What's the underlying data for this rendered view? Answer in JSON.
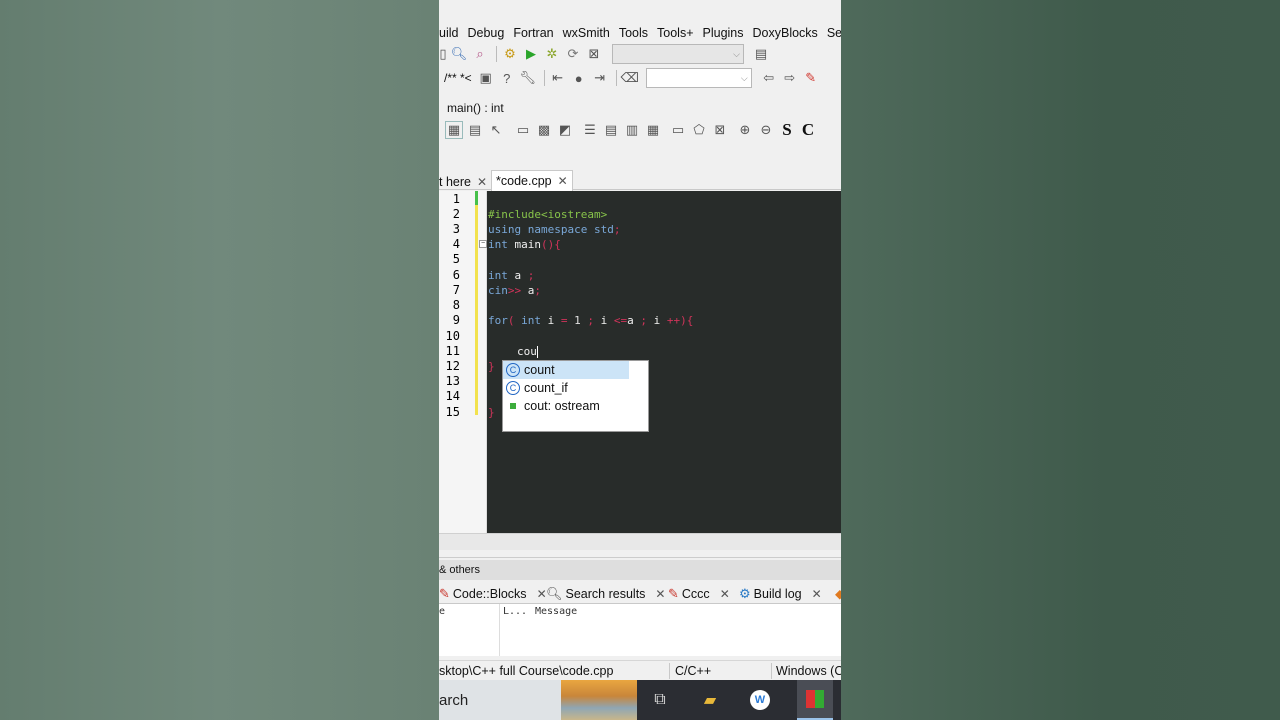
{
  "menu": [
    "uild",
    "Debug",
    "Fortran",
    "wxSmith",
    "Tools",
    "Tools+",
    "Plugins",
    "DoxyBlocks",
    "Settin"
  ],
  "toolbar2": {
    "comment_text": "/** *<"
  },
  "scope": {
    "label": "main() : int"
  },
  "wx_toolbar": {
    "s_label": "S",
    "c_label": "C"
  },
  "editor_tabs": [
    {
      "label": "t here"
    },
    {
      "label": "*code.cpp"
    }
  ],
  "line_numbers": [
    "1",
    "2",
    "3",
    "4",
    "5",
    "6",
    "7",
    "8",
    "9",
    "10",
    "11",
    "12",
    "13",
    "14",
    "15"
  ],
  "code": {
    "l2": "#include<iostream>",
    "l3_kw": "using",
    "l3_ns": " namespace std",
    "l3_end": ";",
    "l4_kw": "int",
    "l4_fn": " main",
    "l4_paren": "(){",
    "l6_kw": "int",
    "l6_var": " a ",
    "l6_end": ";",
    "l7_kw": "cin",
    "l7_op": ">>",
    "l7_var": " a",
    "l7_end": ";",
    "l9_kw": "for",
    "l9_p": "( ",
    "l9_int": "int",
    "l9_i": " i ",
    "l9_eq": "=",
    "l9_one": " 1 ",
    "l9_s1": ";",
    "l9_i2": " i ",
    "l9_le": "<=",
    "l9_a": "a ",
    "l9_s2": ";",
    "l9_i3": " i ",
    "l9_pp": "++){",
    "l11": "cou",
    "l12": "}",
    "l15": "}"
  },
  "autocomplete": [
    {
      "label": "count",
      "icon": "function-icon"
    },
    {
      "label": "count_if",
      "icon": "function-icon"
    },
    {
      "label": "cout: ostream",
      "icon": "variable-icon"
    }
  ],
  "logs": {
    "title": "& others",
    "tabs": [
      "Code::Blocks",
      "Search results",
      "Cccc",
      "Build log"
    ],
    "columns": [
      "e",
      "L...",
      "Message"
    ]
  },
  "status": {
    "path": "sktop\\C++ full Course\\code.cpp",
    "language": "C/C++",
    "eol": "Windows (C"
  },
  "taskbar": {
    "search": "arch"
  }
}
